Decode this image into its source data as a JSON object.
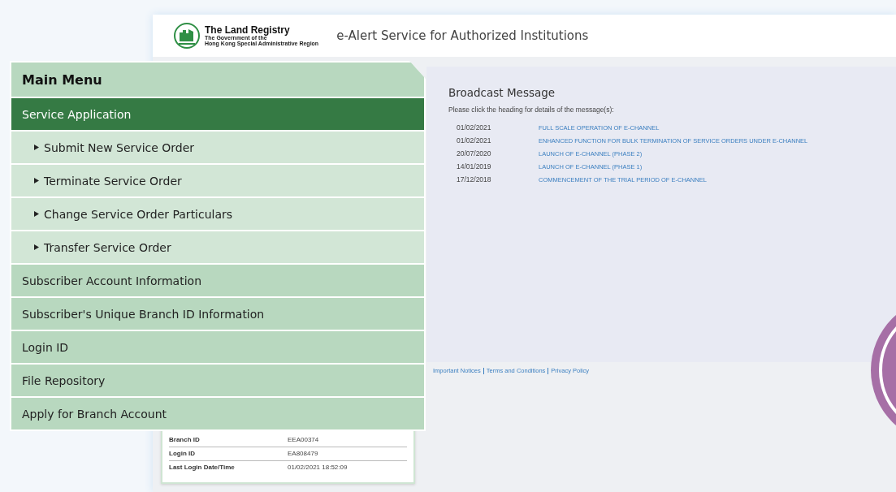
{
  "header": {
    "org_name": "The Land Registry",
    "org_line_1": "The Government of the",
    "org_line_2": "Hong Kong Special Administrative Region",
    "title": "e-Alert Service for Authorized Institutions"
  },
  "main_menu": {
    "title": "Main Menu",
    "items": [
      {
        "label": "Service Application",
        "kind": "section",
        "selected": true
      },
      {
        "label": "Submit New Service Order",
        "kind": "sub",
        "selected": false
      },
      {
        "label": "Terminate Service Order",
        "kind": "sub",
        "selected": false
      },
      {
        "label": "Change Service Order Particulars",
        "kind": "sub",
        "selected": false
      },
      {
        "label": "Transfer Service Order",
        "kind": "sub",
        "selected": false
      },
      {
        "label": "Subscriber Account Information",
        "kind": "section",
        "selected": false
      },
      {
        "label": "Subscriber's Unique Branch ID Information",
        "kind": "section",
        "selected": false
      },
      {
        "label": "Login ID",
        "kind": "section",
        "selected": false
      },
      {
        "label": "File Repository",
        "kind": "section",
        "selected": false
      },
      {
        "label": "Apply for Branch Account",
        "kind": "section",
        "selected": false
      }
    ]
  },
  "account_info": [
    {
      "label": "Branch ID",
      "value": "EEA00374"
    },
    {
      "label": "Login ID",
      "value": "EA808479"
    },
    {
      "label": "Last Login Date/Time",
      "value": "01/02/2021 18:52:09"
    }
  ],
  "broadcast": {
    "title": "Broadcast Message",
    "instruction": "Please click the heading for details of the message(s):",
    "messages": [
      {
        "date": "01/02/2021",
        "heading": "FULL SCALE OPERATION OF E-CHANNEL"
      },
      {
        "date": "01/02/2021",
        "heading": "ENHANCED FUNCTION FOR BULK TERMINATION OF SERVICE ORDERS UNDER E-CHANNEL"
      },
      {
        "date": "20/07/2020",
        "heading": "LAUNCH OF E-CHANNEL (PHASE 2)"
      },
      {
        "date": "14/01/2019",
        "heading": "LAUNCH OF E-CHANNEL (PHASE 1)"
      },
      {
        "date": "17/12/2018",
        "heading": "COMMENCEMENT OF THE TRIAL PERIOD OF E-CHANNEL"
      }
    ]
  },
  "footer_links": [
    "Important Notices",
    "Terms and Conditions",
    "Privacy Policy"
  ]
}
